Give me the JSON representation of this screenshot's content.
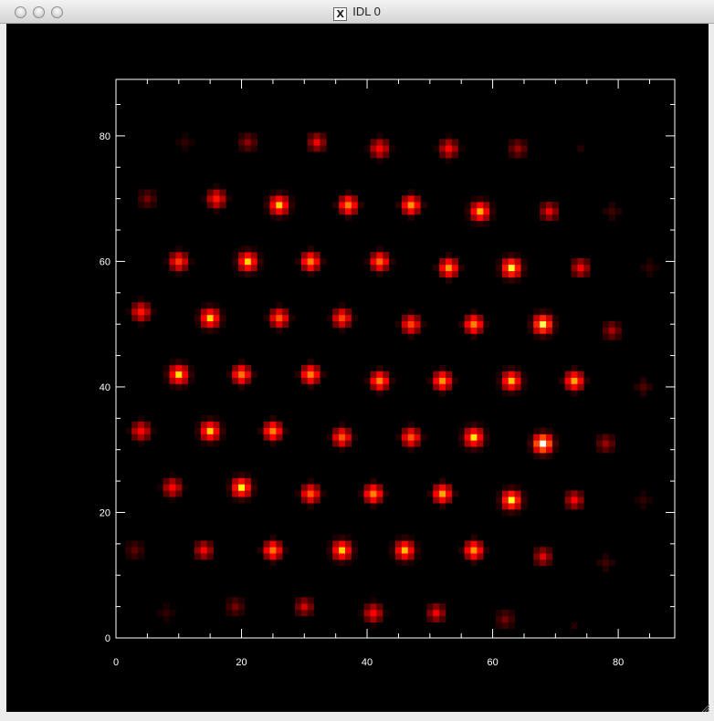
{
  "window": {
    "title": "IDL 0",
    "title_icon": "x11-icon"
  },
  "chart_data": {
    "type": "heatmap",
    "colormap": "red-temperature",
    "xlim": [
      0,
      89
    ],
    "ylim": [
      0,
      89
    ],
    "xticks": [
      0,
      20,
      40,
      60,
      80
    ],
    "yticks": [
      0,
      20,
      40,
      60,
      80
    ],
    "xtick_labels": [
      "0",
      "20",
      "40",
      "60",
      "80"
    ],
    "ytick_labels": [
      "0",
      "20",
      "40",
      "60",
      "80"
    ],
    "background": "#000000",
    "axis_color": "#ffffff",
    "spots": [
      {
        "x": 3,
        "y": 14,
        "v": 0.12
      },
      {
        "x": 14,
        "y": 14,
        "v": 0.35
      },
      {
        "x": 25,
        "y": 14,
        "v": 0.6
      },
      {
        "x": 36,
        "y": 14,
        "v": 0.75
      },
      {
        "x": 46,
        "y": 14,
        "v": 0.72
      },
      {
        "x": 57,
        "y": 14,
        "v": 0.65
      },
      {
        "x": 68,
        "y": 13,
        "v": 0.3
      },
      {
        "x": 78,
        "y": 12,
        "v": 0.08
      },
      {
        "x": 8,
        "y": 4,
        "v": 0.06
      },
      {
        "x": 19,
        "y": 5,
        "v": 0.15
      },
      {
        "x": 30,
        "y": 5,
        "v": 0.28
      },
      {
        "x": 41,
        "y": 4,
        "v": 0.4
      },
      {
        "x": 51,
        "y": 4,
        "v": 0.32
      },
      {
        "x": 62,
        "y": 3,
        "v": 0.15
      },
      {
        "x": 73,
        "y": 2,
        "v": 0.05
      },
      {
        "x": 9,
        "y": 24,
        "v": 0.4
      },
      {
        "x": 20,
        "y": 24,
        "v": 0.82
      },
      {
        "x": 31,
        "y": 23,
        "v": 0.55
      },
      {
        "x": 41,
        "y": 23,
        "v": 0.62
      },
      {
        "x": 52,
        "y": 23,
        "v": 0.68
      },
      {
        "x": 63,
        "y": 22,
        "v": 0.85
      },
      {
        "x": 73,
        "y": 22,
        "v": 0.35
      },
      {
        "x": 84,
        "y": 22,
        "v": 0.06
      },
      {
        "x": 4,
        "y": 33,
        "v": 0.42
      },
      {
        "x": 15,
        "y": 33,
        "v": 0.75
      },
      {
        "x": 25,
        "y": 33,
        "v": 0.62
      },
      {
        "x": 36,
        "y": 32,
        "v": 0.55
      },
      {
        "x": 47,
        "y": 32,
        "v": 0.55
      },
      {
        "x": 57,
        "y": 32,
        "v": 0.78
      },
      {
        "x": 68,
        "y": 31,
        "v": 1.0
      },
      {
        "x": 78,
        "y": 31,
        "v": 0.2
      },
      {
        "x": 10,
        "y": 42,
        "v": 0.78
      },
      {
        "x": 20,
        "y": 42,
        "v": 0.6
      },
      {
        "x": 31,
        "y": 42,
        "v": 0.62
      },
      {
        "x": 42,
        "y": 41,
        "v": 0.62
      },
      {
        "x": 52,
        "y": 41,
        "v": 0.65
      },
      {
        "x": 63,
        "y": 41,
        "v": 0.72
      },
      {
        "x": 73,
        "y": 41,
        "v": 0.68
      },
      {
        "x": 84,
        "y": 40,
        "v": 0.1
      },
      {
        "x": 4,
        "y": 52,
        "v": 0.45
      },
      {
        "x": 15,
        "y": 51,
        "v": 0.75
      },
      {
        "x": 26,
        "y": 51,
        "v": 0.55
      },
      {
        "x": 36,
        "y": 51,
        "v": 0.52
      },
      {
        "x": 47,
        "y": 50,
        "v": 0.52
      },
      {
        "x": 57,
        "y": 50,
        "v": 0.62
      },
      {
        "x": 68,
        "y": 50,
        "v": 0.88
      },
      {
        "x": 79,
        "y": 49,
        "v": 0.22
      },
      {
        "x": 10,
        "y": 60,
        "v": 0.5
      },
      {
        "x": 21,
        "y": 60,
        "v": 0.75
      },
      {
        "x": 31,
        "y": 60,
        "v": 0.62
      },
      {
        "x": 42,
        "y": 60,
        "v": 0.58
      },
      {
        "x": 53,
        "y": 59,
        "v": 0.65
      },
      {
        "x": 63,
        "y": 59,
        "v": 0.85
      },
      {
        "x": 74,
        "y": 59,
        "v": 0.35
      },
      {
        "x": 85,
        "y": 59,
        "v": 0.06
      },
      {
        "x": 5,
        "y": 70,
        "v": 0.15
      },
      {
        "x": 16,
        "y": 70,
        "v": 0.45
      },
      {
        "x": 26,
        "y": 69,
        "v": 0.75
      },
      {
        "x": 37,
        "y": 69,
        "v": 0.62
      },
      {
        "x": 47,
        "y": 69,
        "v": 0.65
      },
      {
        "x": 58,
        "y": 68,
        "v": 0.7
      },
      {
        "x": 69,
        "y": 68,
        "v": 0.32
      },
      {
        "x": 79,
        "y": 68,
        "v": 0.08
      },
      {
        "x": 11,
        "y": 79,
        "v": 0.06
      },
      {
        "x": 21,
        "y": 79,
        "v": 0.18
      },
      {
        "x": 32,
        "y": 79,
        "v": 0.32
      },
      {
        "x": 42,
        "y": 78,
        "v": 0.42
      },
      {
        "x": 53,
        "y": 78,
        "v": 0.38
      },
      {
        "x": 64,
        "y": 78,
        "v": 0.2
      },
      {
        "x": 74,
        "y": 78,
        "v": 0.05
      }
    ]
  }
}
